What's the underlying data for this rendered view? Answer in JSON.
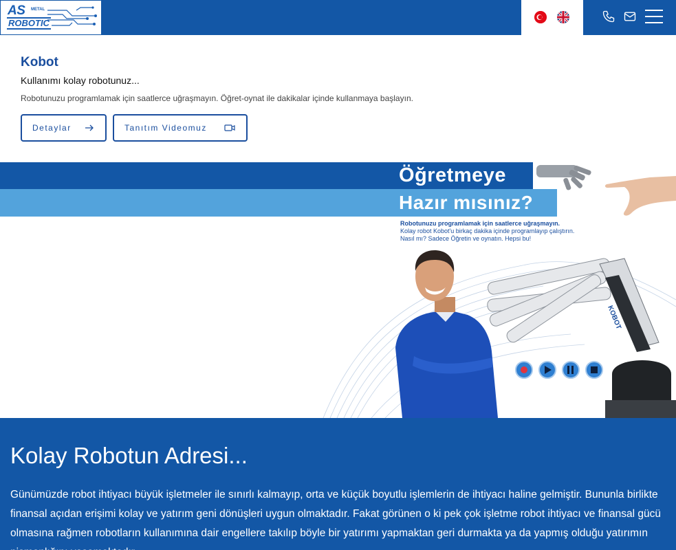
{
  "header": {
    "logo": {
      "as": "AS",
      "metal": "METAL",
      "robotic": "ROBOTIC"
    },
    "languages": [
      "tr",
      "en"
    ],
    "icons": [
      "phone-icon",
      "mail-icon",
      "menu-icon"
    ],
    "colors": {
      "primary": "#1357a6",
      "accent": "#53a3dc"
    }
  },
  "intro": {
    "title": "Kobot",
    "subtitle": "Kullanımı kolay robotunuz...",
    "description": "Robotunuzu programlamak için saatlerce uğraşmayın. Öğret-oynat ile dakikalar içinde kullanmaya başlayın.",
    "buttons": {
      "details": "Detaylar",
      "video": "Tanıtım Videomuz"
    }
  },
  "banner": {
    "headline1": "Öğretmeye",
    "headline2": "Hazır mısınız?",
    "line1": "Robotunuzu programlamak için saatlerce uğraşmayın.",
    "line2": "Kolay robot Kobot'u birkaç dakika içinde programlayıp çalıştırın.",
    "line3": "Nasıl mı? Sadece Öğretin ve oynatın. Hepsi bu!",
    "robot_label": "KOBOT",
    "controls": [
      "record-icon",
      "play-icon",
      "pause-icon",
      "stop-icon"
    ]
  },
  "section": {
    "title": "Kolay Robotun Adresi...",
    "paragraph": "Günümüzde robot ihtiyacı büyük işletmeler ile sınırlı kalmayıp, orta ve küçük boyutlu işlemlerin de ihtiyacı haline gelmiştir. Bununla birlikte finansal açıdan erişimi kolay ve yatırım geni dönüşleri uygun olmaktadır. Fakat görünen o ki pek çok işletme robot ihtiyacı ve finansal gücü olmasına rağmen robotların kullanımına dair engellere takılıp böyle bir yatırımı yapmaktan geri durmakta ya da yapmış olduğu yatırımın pişmanlığını yaşamaktadır."
  }
}
